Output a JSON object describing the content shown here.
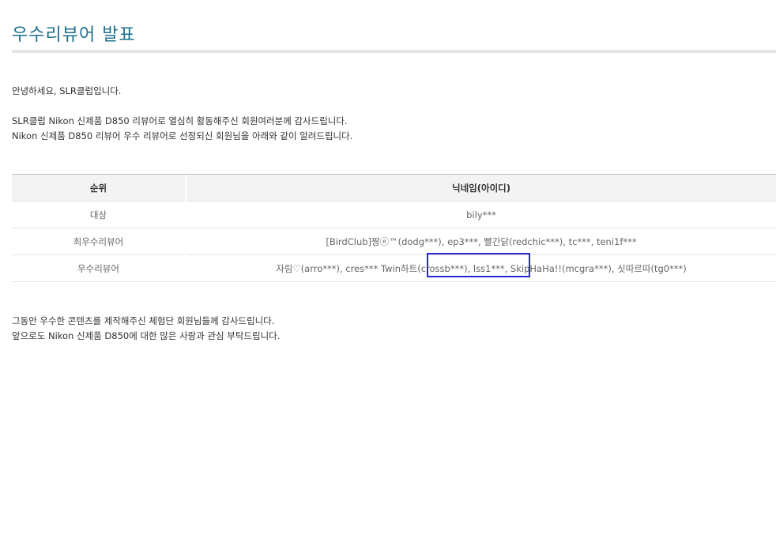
{
  "page": {
    "title": "우수리뷰어 발표"
  },
  "intro": {
    "greeting": "안녕하세요, SLR클럽입니다.",
    "line1": "SLR클럽 Nikon 신제품 D850 리뷰어로 열심히 활동해주신 회원여러분께 감사드립니다.",
    "line2": "Nikon 신제품 D850 리뷰어 우수 리뷰어로 선정되신 회원님을 아래와 같이 알려드립니다."
  },
  "table": {
    "headers": {
      "rank": "순위",
      "nickname": "닉네임(아이디)"
    },
    "rows": [
      {
        "rank": "대상",
        "nicknames": "bily***"
      },
      {
        "rank": "최우수리뷰어",
        "nicknames": "[BirdClub]짱ⓔ™(dodg***), ep3***, 빨간닭(redchic***), tc***, teni1f***"
      },
      {
        "rank": "우수리뷰어",
        "nick_before": "자림♡(arro***), cres*** ",
        "nick_highlight": "Twin하트(crossb***),",
        "nick_after": " lss1***, SkipHaHa!!(mcgra***), 싯따르따(tg0***)"
      }
    ]
  },
  "closing": {
    "line1": "그동안 우수한 콘텐츠를 제작해주신 체험단 회원님들께 감사드립니다.",
    "line2": "앞으로도 Nikon 신제품 D850에 대한 많은 사랑과 관심 부탁드립니다."
  },
  "colors": {
    "title": "#1d6f8c",
    "highlight_border": "#2727d6",
    "header_bg": "#f3f3f3"
  }
}
